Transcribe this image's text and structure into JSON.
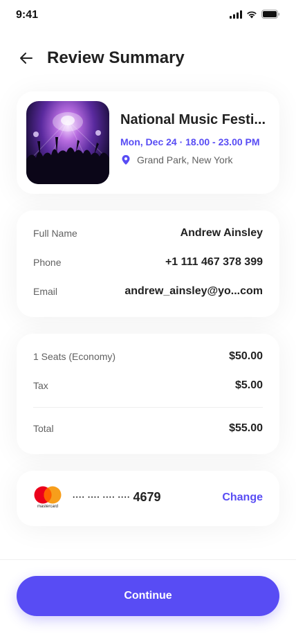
{
  "status_bar": {
    "time": "9:41"
  },
  "header": {
    "title": "Review Summary"
  },
  "event": {
    "title": "National Music Festi...",
    "date": "Mon, Dec 24 · 18.00 - 23.00 PM",
    "location": "Grand Park, New York"
  },
  "details": {
    "name_label": "Full Name",
    "name_value": "Andrew Ainsley",
    "phone_label": "Phone",
    "phone_value": "+1 111 467 378 399",
    "email_label": "Email",
    "email_value": "andrew_ainsley@yo...com"
  },
  "pricing": {
    "seats_label": "1 Seats (Economy)",
    "seats_value": "$50.00",
    "tax_label": "Tax",
    "tax_value": "$5.00",
    "total_label": "Total",
    "total_value": "$55.00"
  },
  "payment": {
    "brand": "mastercard",
    "masked": "···· ···· ···· ····",
    "last4": "4679",
    "change_label": "Change"
  },
  "footer": {
    "continue_label": "Continue"
  },
  "colors": {
    "accent": "#584CF4",
    "text": "#212121",
    "muted": "#616161"
  }
}
